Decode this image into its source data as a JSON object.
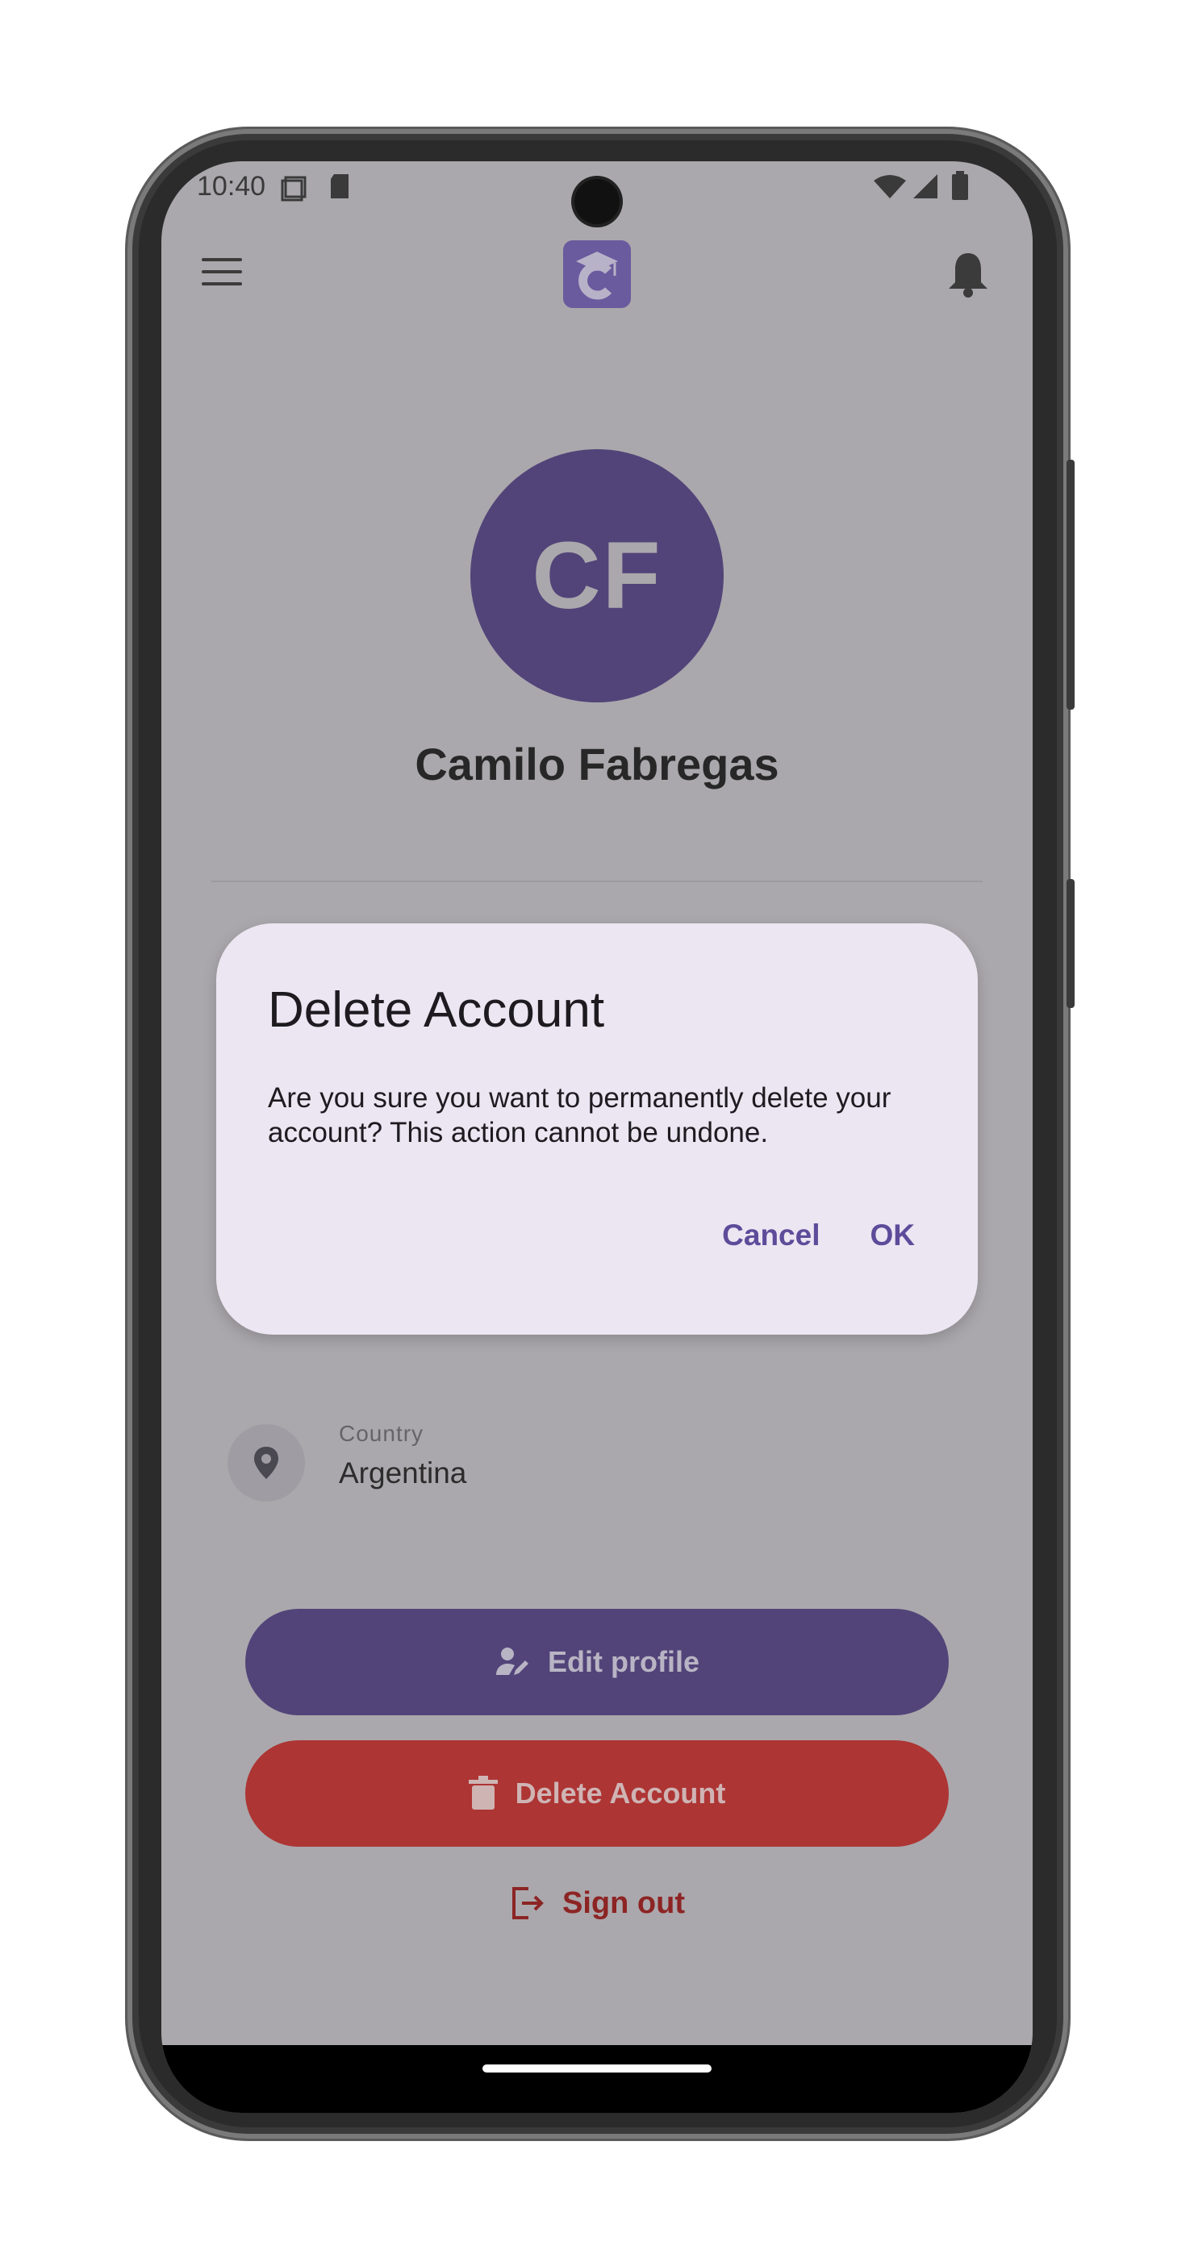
{
  "status_bar": {
    "time": "10:40"
  },
  "profile": {
    "initials": "CF",
    "name": "Camilo Fabregas",
    "fields": [
      {
        "label": "Country",
        "value": "Argentina",
        "icon": "location-pin-icon"
      }
    ]
  },
  "actions": {
    "edit_label": "Edit profile",
    "delete_label": "Delete Account",
    "signout_label": "Sign out"
  },
  "dialog": {
    "title": "Delete Account",
    "message": "Are you sure you want to permanently delete your account? This action cannot be undone.",
    "cancel_label": "Cancel",
    "ok_label": "OK"
  },
  "colors": {
    "primary": "#524479",
    "danger": "#ad3534",
    "scrim_background": "#aaa8ac",
    "dialog_background": "#ece6f2",
    "dialog_accent": "#5e4b9a"
  },
  "icons": [
    "menu-icon",
    "app-logo-icon",
    "bell-icon",
    "location-pin-icon",
    "edit-user-icon",
    "trash-icon",
    "logout-icon",
    "wifi-icon",
    "signal-icon",
    "battery-icon"
  ]
}
